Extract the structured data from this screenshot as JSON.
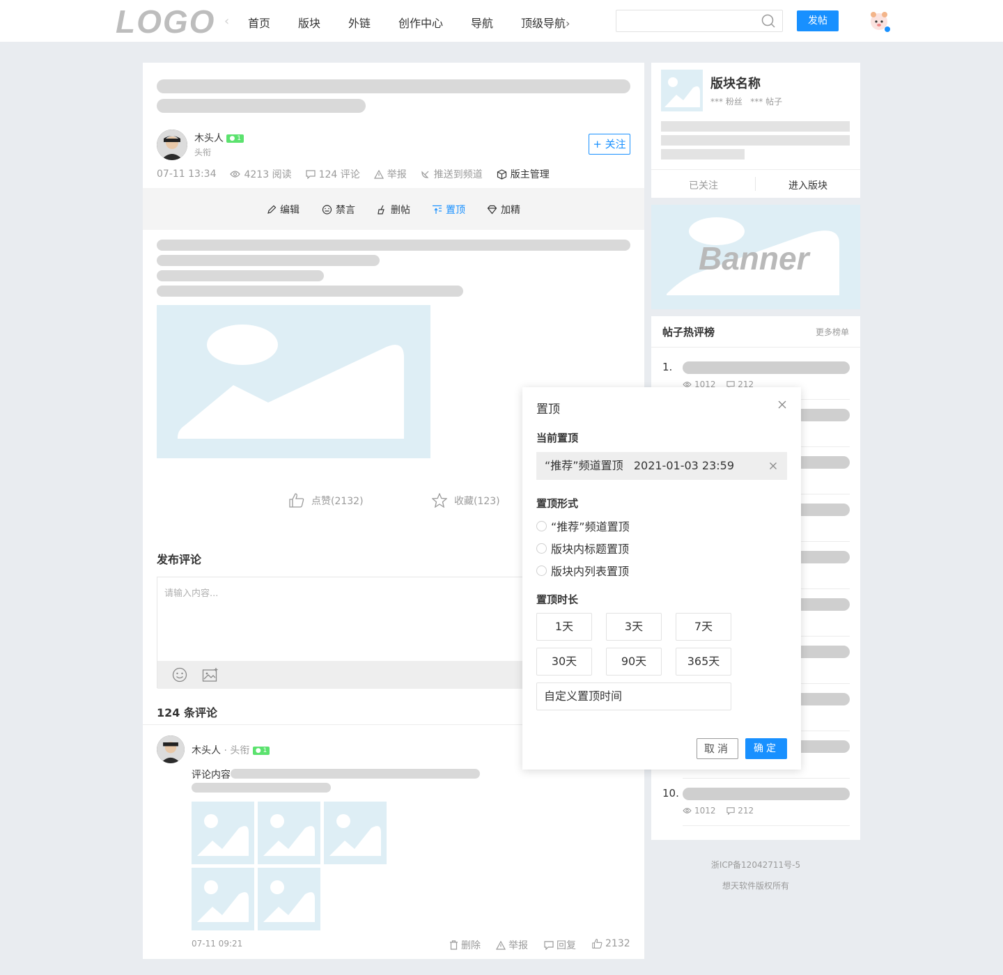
{
  "header": {
    "logo": "LOGO",
    "nav": [
      "首页",
      "版块",
      "外链",
      "创作中心",
      "导航",
      "顶级导航"
    ],
    "post_button": "发帖",
    "search_placeholder": ""
  },
  "post": {
    "author_name": "木头人",
    "author_level": "1",
    "author_title": "头衔",
    "follow_button": "+ 关注",
    "meta": {
      "time": "07-11 13:34",
      "views": "4213 阅读",
      "comments": "124 评论",
      "report": "举报",
      "push": "推送到频道",
      "moderate": "版主管理"
    },
    "mod_actions": [
      "编辑",
      "禁言",
      "删帖",
      "置顶",
      "加精"
    ],
    "like": "点赞(2132)",
    "favorite": "收藏(123)"
  },
  "comment_form": {
    "title": "发布评论",
    "placeholder": "请输入内容..."
  },
  "comments": {
    "count_title": "124 条评论",
    "item": {
      "author": "木头人",
      "title": "· 头衔",
      "level": "1",
      "content_prefix": "评论内容",
      "time": "07-11 09:21",
      "delete": "删除",
      "report": "举报",
      "reply": "回复",
      "likes": "2132"
    }
  },
  "board": {
    "name": "版块名称",
    "stats": "*** 粉丝   *** 帖子",
    "followed": "已关注",
    "enter": "进入版块"
  },
  "banner": {
    "text": "Banner"
  },
  "ranking": {
    "title": "帖子热评榜",
    "more": "更多榜单",
    "first_num": "1.",
    "last_num": "10.",
    "views": "1012",
    "comments": "212"
  },
  "footer": {
    "icp": "浙ICP备12042711号-5",
    "copyright": "想天软件版权所有"
  },
  "modal": {
    "title": "置顶",
    "current_label": "当前置顶",
    "current_value": "“推荐”频道置顶   2021-01-03 23:59",
    "form_label": "置顶形式",
    "options": [
      "“推荐”频道置顶",
      "版块内标题置顶",
      "版块内列表置顶"
    ],
    "duration_label": "置顶时长",
    "durations": [
      "1天",
      "3天",
      "7天",
      "30天",
      "90天",
      "365天"
    ],
    "custom": "自定义置顶时间",
    "cancel": "取消",
    "ok": "确定"
  },
  "colors": {
    "accent": "#1890ff",
    "level_badge": "#5be26e",
    "placeholder_image": "#deeef5"
  }
}
